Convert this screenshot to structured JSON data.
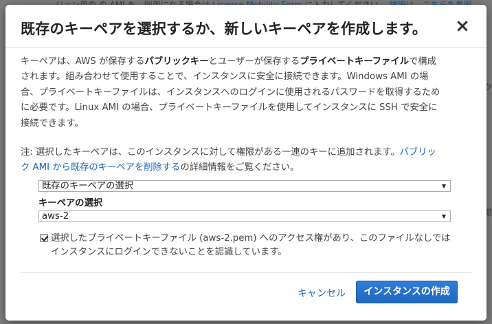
{
  "background": {
    "top_text": "ジョン用の",
    "top_text_2": "の AMI を、別用になる場合は",
    "top_link": "License Mobility Form",
    "top_text_3": " に入力してください。",
    "top_link_2": "詳細は、こちらを参照",
    "right_char_1": "ク",
    "right_char_2": "期"
  },
  "modal": {
    "title": "既存のキーペアを選択するか、新しいキーペアを作成します。",
    "close_glyph": "×",
    "description": {
      "p1_a": "キーペアは、AWS が保存する",
      "p1_b": "パブリックキー",
      "p1_c": "とユーザーが保存する",
      "p1_d": "プライベートキーファイル",
      "p1_e": "で構成されます。組み合わせて使用することで、インスタンスに安全に接続できます。Windows AMI の場合、プライベートキーファイルは、インスタンスへのログインに使用されるパスワードを取得するために必要です。Linux AMI の場合、プライベートキーファイルを使用してインスタンスに SSH で安全に接続できます。"
    },
    "note": {
      "prefix": "注: 選択したキーペアは、このインスタンスに対して権限がある一連のキーに追加されます。",
      "link": "パブリック AMI から既存のキーペアを削除する",
      "suffix": "の詳細情報をご覧ください。"
    },
    "keypair_mode_select": "既存のキーペアの選択",
    "keypair_label": "キーペアの選択",
    "keypair_select": "aws-2",
    "acknowledge_text": "選択したプライベートキーファイル (aws-2.pem) へのアクセス権があり、このファイルなしではインスタンスにログインできないことを認識しています。",
    "acknowledge_checked": true,
    "cancel_label": "キャンセル",
    "create_label": "インスタンスの作成"
  },
  "colors": {
    "link": "#1667b7",
    "primary_button": "#2a74cc",
    "title_text": "#222222",
    "body_text": "#444444"
  }
}
